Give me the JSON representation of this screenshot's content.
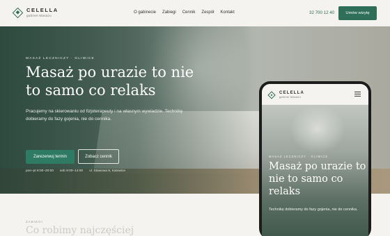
{
  "brand": {
    "name": "CELELLA",
    "tagline": "gabinet Masażu"
  },
  "nav": {
    "items": [
      "O gabinecie",
      "Zabiegi",
      "Cennik",
      "Zespół",
      "Kontakt"
    ]
  },
  "header": {
    "phone": "32 700 12 40",
    "cta_label": "Umów wizytę"
  },
  "hero": {
    "eyebrow": "MASAŻ LECZNICZY · GLIWICE",
    "headline": "Masaż po urazie to nie to samo co relaks",
    "lead": "Pracujemy na skierowaniu od fizjoterapeuty i na własnym wywiadzie. Technikę dobieramy do fazy gojenia, nie do cennika.",
    "primary_button": "Zarezerwuj termin",
    "secondary_button": "Zobacz cennik",
    "meta": [
      "pon–pt 8:00–20:00",
      "sob 9:00–14:00",
      "ul. Stawowa 8, Katowice"
    ]
  },
  "section": {
    "label": "ZABIEGI",
    "title": "Co robimy najczęściej"
  },
  "mobile": {
    "brand_name": "CELELLA",
    "brand_tagline": "gabinet Masażu",
    "eyebrow": "MASAŻ LECZNICZY · GLIWICE",
    "headline": "Masaż po urazie to nie to samo co relaks",
    "lead": "Technikę dobieramy do fazy gojenia, nie do cennika."
  },
  "colors": {
    "accent": "#2f6f5a",
    "background": "#f5f3ef"
  },
  "icons": {
    "logo": "diamond-logo-icon",
    "menu": "hamburger-menu-icon"
  }
}
